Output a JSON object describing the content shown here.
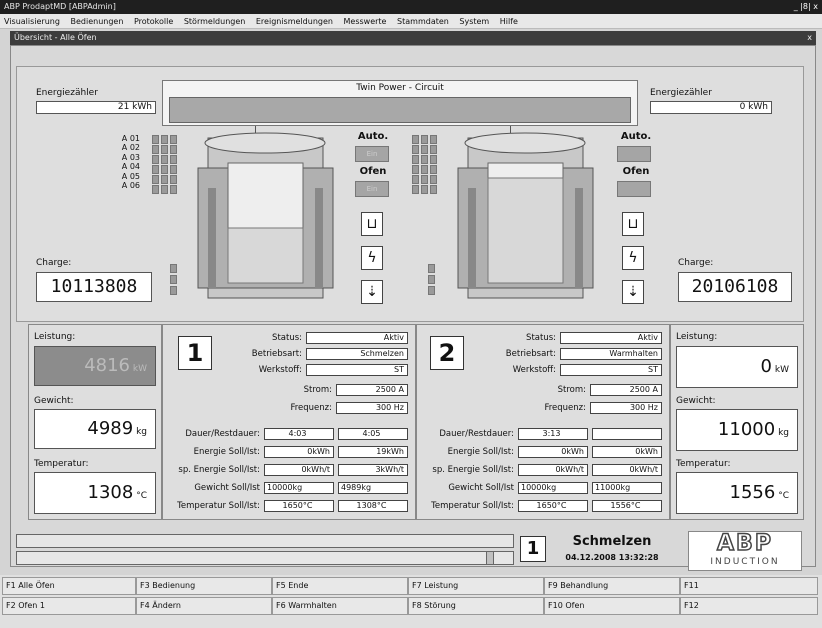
{
  "window": {
    "title": "ABP ProdaptMD [ABPAdmin]",
    "controls": "_ |8| x"
  },
  "menu": [
    "Visualisierung",
    "Bedienungen",
    "Protokolle",
    "Störmeldungen",
    "Ereignismeldungen",
    "Messwerte",
    "Stammdaten",
    "System",
    "Hilfe"
  ],
  "mdi": {
    "title": "Übersicht - Alle Öfen",
    "close": "x"
  },
  "twin": {
    "title": "Twin Power - Circuit"
  },
  "left": {
    "energy_label": "Energiezähler",
    "energy_value": "21 kWh",
    "slots": [
      "A 01",
      "A 02",
      "A 03",
      "A 04",
      "A 05",
      "A 06"
    ],
    "auto_label": "Auto.",
    "ofen_label": "Ofen",
    "auto_state": "Ein",
    "ofen_state": "Ein",
    "charge_label": "Charge:",
    "charge_value": "10113808",
    "leistung_label": "Leistung:",
    "leistung_value": "4816",
    "leistung_unit": "kW",
    "gewicht_label": "Gewicht:",
    "gewicht_value": "4989",
    "gewicht_unit": "kg",
    "temp_label": "Temperatur:",
    "temp_value": "1308",
    "temp_unit": "°C"
  },
  "right": {
    "energy_label": "Energiezähler",
    "energy_value": "0 kWh",
    "auto_label": "Auto.",
    "ofen_label": "Ofen",
    "charge_label": "Charge:",
    "charge_value": "20106108",
    "leistung_label": "Leistung:",
    "leistung_value": "0",
    "leistung_unit": "kW",
    "gewicht_label": "Gewicht:",
    "gewicht_value": "11000",
    "gewicht_unit": "kg",
    "temp_label": "Temperatur:",
    "temp_value": "1556",
    "temp_unit": "°C"
  },
  "labels": {
    "status": "Status:",
    "betriebsart": "Betriebsart:",
    "werkstoff": "Werkstoff:",
    "strom": "Strom:",
    "frequenz": "Frequenz:",
    "dauer": "Dauer/Restdauer:",
    "energie": "Energie Soll/Ist:",
    "sp_energie": "sp. Energie Soll/Ist:",
    "gewicht": "Gewicht Soll/Ist",
    "temperatur": "Temperatur Soll/Ist:"
  },
  "oven1": {
    "number": "1",
    "status": "Aktiv",
    "betriebsart": "Schmelzen",
    "werkstoff": "ST",
    "strom": "2500 A",
    "frequenz": "300 Hz",
    "dauer": [
      "4:03",
      "4:05"
    ],
    "energie": [
      "0kWh",
      "19kWh"
    ],
    "sp_energie": [
      "0kWh/t",
      "3kWh/t"
    ],
    "gewicht": [
      "10000kg",
      "4989kg"
    ],
    "temperatur": [
      "1650°C",
      "1308°C"
    ]
  },
  "oven2": {
    "number": "2",
    "status": "Aktiv",
    "betriebsart": "Warmhalten",
    "werkstoff": "ST",
    "strom": "2500 A",
    "frequenz": "300 Hz",
    "dauer": [
      "3:13",
      ""
    ],
    "energie": [
      "0kWh",
      "0kWh"
    ],
    "sp_energie": [
      "0kWh/t",
      "0kWh/t"
    ],
    "gewicht": [
      "10000kg",
      "11000kg"
    ],
    "temperatur": [
      "1650°C",
      "1556°C"
    ]
  },
  "statusbar": {
    "oven": "1",
    "mode": "Schmelzen",
    "datetime": "04.12.2008 13:32:28",
    "logo_top": "ABP",
    "logo_bottom": "INDUCTION"
  },
  "fkeys": [
    [
      "F1 Alle Öfen",
      "F3 Bedienung",
      "F5 Ende",
      "F7 Leistung",
      "F9 Behandlung",
      "F11"
    ],
    [
      "F2 Ofen 1",
      "F4 Ändern",
      "F6 Warmhalten",
      "F8 Störung",
      "F10 Ofen",
      "F12"
    ]
  ],
  "colors": {
    "title_bar": "#1f1f1f",
    "active_power": "#8c8c8c",
    "panel": "#dedede"
  }
}
